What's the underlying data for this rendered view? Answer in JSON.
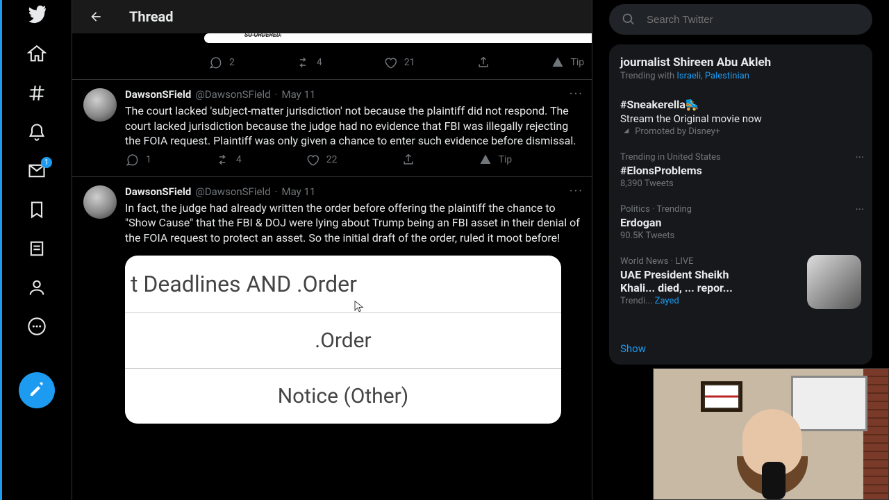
{
  "header": {
    "title": "Thread"
  },
  "search": {
    "placeholder": "Search Twitter"
  },
  "nav": {
    "messages_badge": "1"
  },
  "top_actions": {
    "reply": "2",
    "retweet": "4",
    "like": "21",
    "tip": "Tip"
  },
  "tweet1": {
    "name": "DawsonSField",
    "handle": "@DawsonSField",
    "sep": "·",
    "date": "May 11",
    "text": "The court lacked 'subject-matter jurisdiction' not because the plaintiff did not respond. The court lacked jurisdiction because the judge had no evidence that FBI was illegally rejecting the FOIA request. Plaintiff was only given a chance to enter such evidence before dismissal.",
    "actions": {
      "reply": "1",
      "retweet": "4",
      "like": "22",
      "tip": "Tip"
    }
  },
  "tweet2": {
    "name": "DawsonSField",
    "handle": "@DawsonSField",
    "sep": "·",
    "date": "May 11",
    "text": "In fact, the judge had already written the order before offering the plaintiff the chance to \"Show Cause\" that the FBI & DOJ were lying about Trump being an FBI asset in their denial of the FOIA request to protect an asset. So the initial draft of the order, ruled it moot before!",
    "embed": {
      "row1": "t Deadlines AND .Order",
      "row2": ".Order",
      "row3": "Notice (Other)"
    }
  },
  "sidebar": {
    "top_trend": {
      "title_partial": "journalist Shireen Abu Akleh",
      "with_label": "Trending with",
      "link1": "Israeli",
      "link2": "Palestinian"
    },
    "promo": {
      "title": "#Sneakerella🛼",
      "sub": "Stream the Original movie now",
      "by": "Promoted by Disney+"
    },
    "trend2": {
      "meta": "Trending in United States",
      "title": "#ElonsProblems",
      "sub": "8,390 Tweets"
    },
    "trend3": {
      "meta": "Politics · Trending",
      "title": "Erdogan",
      "sub": "90.5K Tweets"
    },
    "trend4": {
      "meta": "World News · LIVE",
      "title": "UAE President Sheikh Khali... died, ... repor...",
      "with_label": "Trendi...",
      "link": "Zayed"
    },
    "show_more": "Show"
  }
}
